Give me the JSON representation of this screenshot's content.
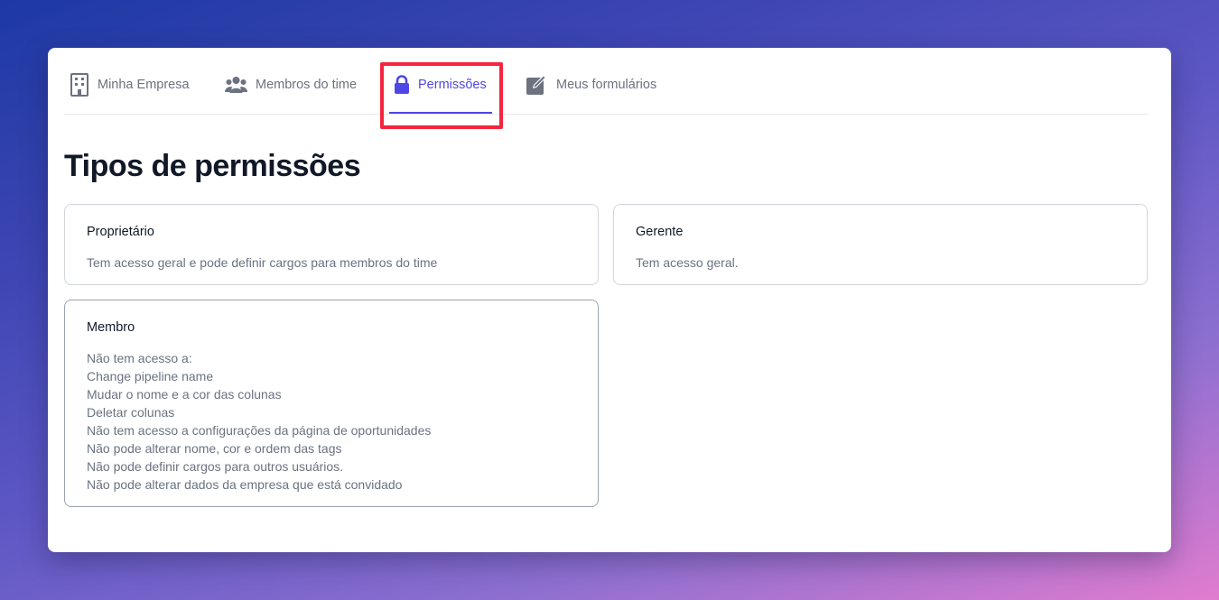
{
  "tabs": [
    {
      "label": "Minha Empresa",
      "icon": "building-icon"
    },
    {
      "label": "Membros do time",
      "icon": "users-icon"
    },
    {
      "label": "Permissões",
      "icon": "lock-icon",
      "active": true
    },
    {
      "label": "Meus formulários",
      "icon": "edit-icon"
    }
  ],
  "page_title": "Tipos de permissões",
  "cards": {
    "owner": {
      "title": "Proprietário",
      "description": "Tem acesso geral e pode definir cargos para membros do time"
    },
    "manager": {
      "title": "Gerente",
      "description": "Tem acesso geral."
    },
    "member": {
      "title": "Membro",
      "lines": [
        "Não tem acesso a:",
        "Change pipeline name",
        "Mudar o nome e a cor das colunas",
        "Deletar colunas",
        "Não tem acesso a configurações da página de oportunidades",
        "Não pode alterar nome, cor e ordem das tags",
        "Não pode definir cargos para outros usuários.",
        "Não pode alterar dados da empresa que está convidado"
      ]
    }
  },
  "colors": {
    "accent": "#4f46e5",
    "highlight": "#f4253d",
    "icon_gray": "#6b7280"
  }
}
